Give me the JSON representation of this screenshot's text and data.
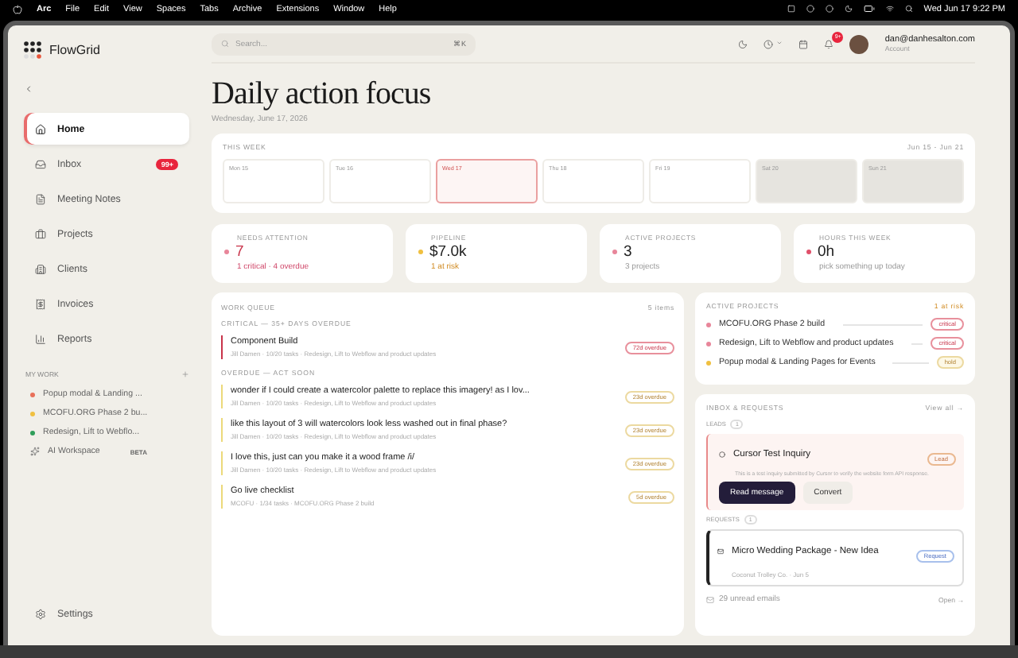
{
  "menu_bar": {
    "app": "Arc",
    "items": [
      "File",
      "Edit",
      "View",
      "Spaces",
      "Tabs",
      "Archive",
      "Extensions",
      "Window",
      "Help"
    ],
    "clock": "Wed Jun 17  9:22 PM"
  },
  "sidebar": {
    "brand": "FlowGrid",
    "nav": [
      {
        "label": "Home",
        "selected": true
      },
      {
        "label": "Inbox",
        "selected": false,
        "badge": "99+"
      },
      {
        "label": "Meeting Notes",
        "selected": false
      },
      {
        "label": "Projects",
        "selected": false
      },
      {
        "label": "Clients",
        "selected": false
      },
      {
        "label": "Invoices",
        "selected": false
      },
      {
        "label": "Reports",
        "selected": false
      }
    ],
    "section_title": "MY WORK",
    "work": [
      {
        "label": "Popup modal & Landing ...",
        "color": "#e8705a"
      },
      {
        "label": "MCOFU.ORG Phase 2 bu...",
        "color": "#f0c040"
      },
      {
        "label": "Redesign, Lift to Webflo...",
        "color": "#2f9e5a"
      }
    ],
    "ai": {
      "label": "AI Workspace",
      "badge": "BETA"
    },
    "settings": "Settings"
  },
  "header": {
    "search_placeholder": "Search...",
    "shortcut": "⌘K",
    "notifications": "9+",
    "account_email": "dan@danhesalton.com",
    "account_label": "Account"
  },
  "page": {
    "title": "Daily action focus",
    "date": "Wednesday, June 17, 2026"
  },
  "week": {
    "title": "THIS WEEK",
    "range": "Jun 15 - Jun 21",
    "days": [
      {
        "label": "Mon 15",
        "kind": "weekday",
        "selected": false
      },
      {
        "label": "Tue 16",
        "kind": "weekday",
        "selected": false
      },
      {
        "label": "Wed 17",
        "kind": "weekday",
        "selected": true
      },
      {
        "label": "Thu 18",
        "kind": "weekday",
        "selected": false
      },
      {
        "label": "Fri 19",
        "kind": "weekday",
        "selected": false
      },
      {
        "label": "Sat 20",
        "kind": "weekend",
        "selected": false
      },
      {
        "label": "Sun 21",
        "kind": "weekend",
        "selected": false
      }
    ]
  },
  "stats": [
    {
      "label": "NEEDS ATTENTION",
      "value": "7",
      "note": "1 critical · 4 overdue",
      "color": "#e8869a",
      "kind": "critical"
    },
    {
      "label": "PIPELINE",
      "value": "$7.0k",
      "note": "1 at risk",
      "color": "#f0c040",
      "kind": "warning"
    },
    {
      "label": "ACTIVE PROJECTS",
      "value": "3",
      "note": "3 projects",
      "color": "#e8869a",
      "kind": "neutral"
    },
    {
      "label": "HOURS THIS WEEK",
      "value": "0h",
      "note": "pick something up today",
      "color": "#e0506a",
      "kind": "neutral"
    }
  ],
  "work_queue": {
    "title": "WORK QUEUE",
    "count": "5 items",
    "groups": [
      {
        "title": "CRITICAL — 35+ DAYS OVERDUE",
        "items": [
          {
            "title": "Component Build",
            "meta": "Jill Damen · 10/20 tasks · Redesign, Lift to Webflow and product updates",
            "badge": "72d overdue",
            "kind": "critical"
          }
        ]
      },
      {
        "title": "OVERDUE — ACT SOON",
        "items": [
          {
            "title": "wonder if I could create a watercolor palette to replace this imagery! as I lov...",
            "meta": "Jill Damen · 10/20 tasks · Redesign, Lift to Webflow and product updates",
            "badge": "23d overdue",
            "kind": "overdue"
          },
          {
            "title": "like this layout of 3 will watercolors look less washed out in final phase?",
            "meta": "Jill Damen · 10/20 tasks · Redesign, Lift to Webflow and product updates",
            "badge": "23d overdue",
            "kind": "overdue"
          },
          {
            "title": "I love this, just can you make it a wood frame /i/",
            "meta": "Jill Damen · 10/20 tasks · Redesign, Lift to Webflow and product updates",
            "badge": "23d overdue",
            "kind": "overdue"
          },
          {
            "title": "Go live checklist",
            "meta": "MCOFU · 1/34 tasks · MCOFU.ORG Phase 2 build",
            "badge": "5d overdue",
            "kind": "overdue"
          }
        ]
      }
    ]
  },
  "active_projects": {
    "title": "ACTIVE PROJECTS",
    "note": "1 at risk",
    "items": [
      {
        "name": "MCOFU.ORG Phase 2 build",
        "color": "#e8869a",
        "status": "critical",
        "kind": "critical"
      },
      {
        "name": "Redesign, Lift to Webflow and product updates",
        "color": "#e8869a",
        "status": "critical",
        "kind": "critical"
      },
      {
        "name": "Popup modal & Landing Pages for Events",
        "color": "#f0c040",
        "status": "hold",
        "kind": "hold"
      }
    ]
  },
  "inbox": {
    "title": "INBOX & REQUESTS",
    "link": "View all →",
    "leads": {
      "label": "LEADS",
      "count": "1",
      "title": "Cursor Test Inquiry",
      "text": "This is a test inquiry submitted by Cursor to verify the website form API response.",
      "badge": "Lead",
      "actions": [
        "Read message",
        "Convert"
      ]
    },
    "requests": {
      "label": "REQUESTS",
      "count": "1",
      "title": "Micro Wedding Package - New Idea",
      "meta": "Coconut Trolley Co. · Jun 5",
      "badge": "Request"
    },
    "footer": "29 unread emails",
    "footer_link": "Open →"
  }
}
